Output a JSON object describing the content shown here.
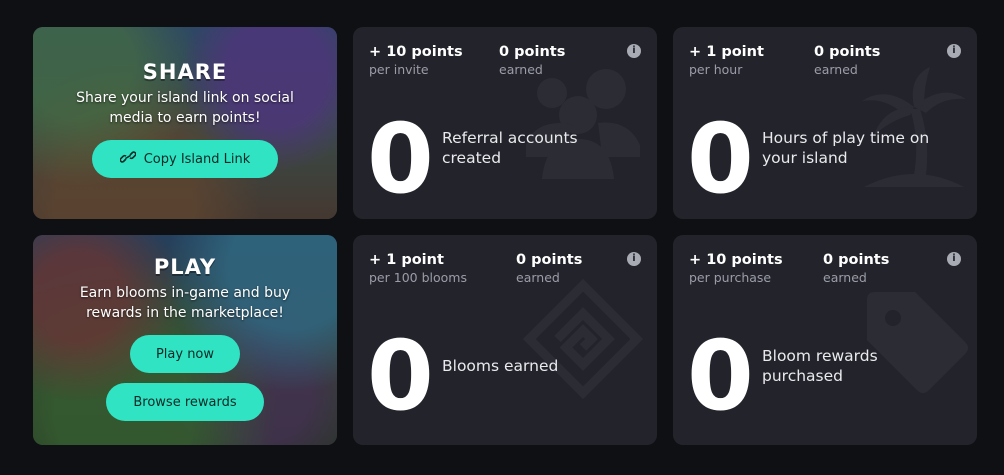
{
  "share": {
    "title": "SHARE",
    "description": "Share your island link on social media to earn points!",
    "button_label": "Copy Island Link",
    "button_icon": "link-icon"
  },
  "play": {
    "title": "PLAY",
    "description": "Earn blooms in-game and buy rewards in the marketplace!",
    "play_button_label": "Play now",
    "browse_button_label": "Browse rewards"
  },
  "stats": [
    {
      "rate": "+ 10 points",
      "rate_sub": "per invite",
      "earned": "0 points",
      "earned_sub": "earned",
      "count": "0",
      "label": "Referral accounts created",
      "icon": "users-icon"
    },
    {
      "rate": "+ 1 point",
      "rate_sub": "per hour",
      "earned": "0 points",
      "earned_sub": "earned",
      "count": "0",
      "label": "Hours of play time on your island",
      "icon": "palm-tree-icon"
    },
    {
      "rate": "+ 1 point",
      "rate_sub": "per 100 blooms",
      "earned": "0 points",
      "earned_sub": "earned",
      "count": "0",
      "label": "Blooms earned",
      "icon": "bloom-icon"
    },
    {
      "rate": "+ 10 points",
      "rate_sub": "per purchase",
      "earned": "0 points",
      "earned_sub": "earned",
      "count": "0",
      "label": "Bloom rewards purchased",
      "icon": "tag-icon"
    }
  ],
  "colors": {
    "accent": "#2fe3c3",
    "card_bg": "#23242b",
    "page_bg": "#0f1014"
  }
}
